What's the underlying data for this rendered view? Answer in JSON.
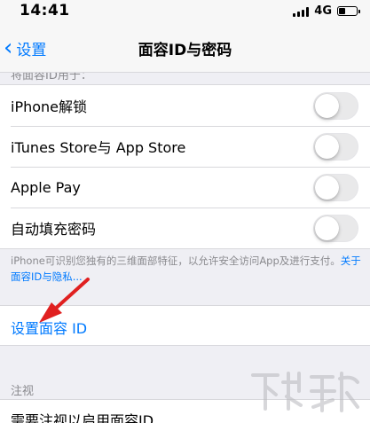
{
  "status_bar": {
    "time": "14:41",
    "network": "4G"
  },
  "nav": {
    "back_label": "设置",
    "title": "面容ID与密码"
  },
  "section_header": "将面容ID用于：",
  "toggle_rows": [
    {
      "label": "iPhone解锁",
      "on": false
    },
    {
      "label": "iTunes Store与 App Store",
      "on": false
    },
    {
      "label": "Apple Pay",
      "on": false
    },
    {
      "label": "自动填充密码",
      "on": false
    }
  ],
  "footer": {
    "text": "iPhone可识别您独有的三维面部特征，以允许安全访问App及进行支付。",
    "link": "关于面容ID与隐私..."
  },
  "setup": {
    "label": "设置面容 ID"
  },
  "attention": {
    "header": "注视",
    "row_label": "需要注视以启用面容ID"
  },
  "colors": {
    "accent": "#007aff",
    "annotation": "#e02020",
    "background": "#efeff4"
  }
}
